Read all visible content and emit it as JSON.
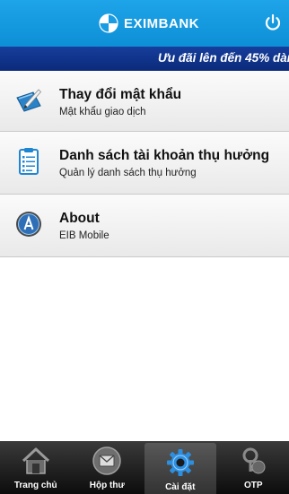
{
  "header": {
    "brand_name": "EXIMBANK",
    "brand_icon": "eximbank-logo",
    "power_icon": "power-icon",
    "color": "#1a9ce2"
  },
  "ticker": {
    "text": "Ưu đãi lên đến 45% dàn",
    "color": "#0f3185"
  },
  "menu": {
    "items": [
      {
        "title": "Thay đổi mật khẩu",
        "subtitle": "Mật khẩu giao dịch",
        "icon": "password-card-icon"
      },
      {
        "title": "Danh sách tài khoản thụ hưởng",
        "subtitle": "Quản lý danh sách thụ hưởng",
        "icon": "clipboard-list-icon"
      },
      {
        "title": "About",
        "subtitle": "EIB Mobile",
        "icon": "about-icon"
      }
    ]
  },
  "tabs": {
    "active_index": 2,
    "items": [
      {
        "label": "Trang chủ",
        "icon": "home-icon"
      },
      {
        "label": "Hộp thư",
        "icon": "mail-icon"
      },
      {
        "label": "Cài đặt",
        "icon": "settings-gear-icon"
      },
      {
        "label": "OTP",
        "icon": "otp-key-icon"
      }
    ]
  }
}
